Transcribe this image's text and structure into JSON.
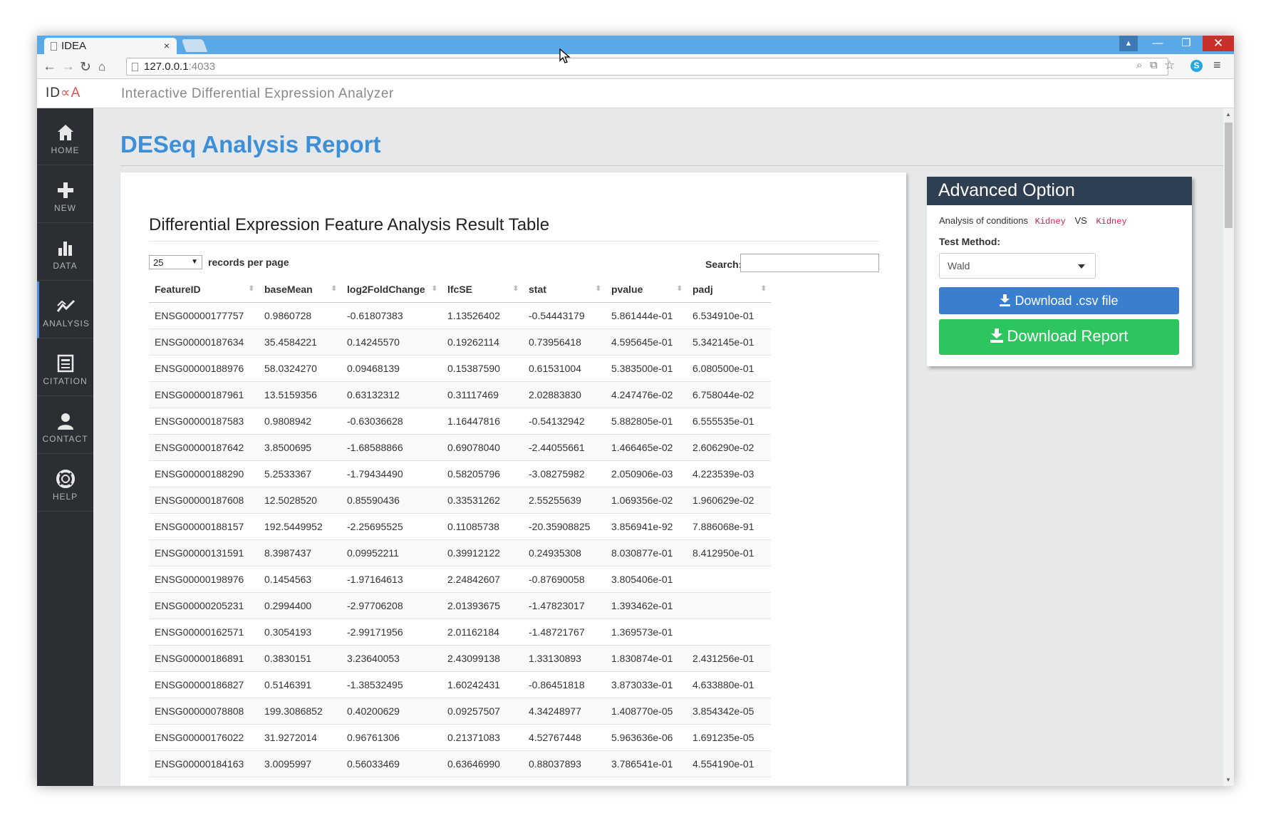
{
  "browser": {
    "tab_title": "IDEA",
    "tab_close": "×",
    "url_host": "127.0.0.1",
    "url_port": ":4033",
    "window_min": "—",
    "window_max": "❐",
    "window_close": "✕",
    "user_icon": "user-icon"
  },
  "app": {
    "logo_text": "ID",
    "logo_wave": "∝A",
    "title": "Interactive Differential Expression Analyzer"
  },
  "sidebar": {
    "items": [
      {
        "label": "HOME",
        "icon": "home-icon"
      },
      {
        "label": "NEW",
        "icon": "plus-icon"
      },
      {
        "label": "DATA",
        "icon": "bar-chart-icon"
      },
      {
        "label": "ANALYSIS",
        "icon": "line-chart-icon",
        "active": true
      },
      {
        "label": "CITATION",
        "icon": "document-icon"
      },
      {
        "label": "CONTACT",
        "icon": "user-icon"
      },
      {
        "label": "HELP",
        "icon": "lifebuoy-icon"
      }
    ]
  },
  "main": {
    "page_title": "DESeq Analysis Report",
    "panel_heading": "Differential Expression Feature Analysis Result Table",
    "length_value": "25",
    "length_label": "records per page",
    "search_label": "Search:",
    "table": {
      "headers": [
        "FeatureID",
        "baseMean",
        "log2FoldChange",
        "lfcSE",
        "stat",
        "pvalue",
        "padj"
      ],
      "rows": [
        [
          "ENSG00000177757",
          "0.9860728",
          "-0.61807383",
          "1.13526402",
          "-0.54443179",
          "5.861444e-01",
          "6.534910e-01"
        ],
        [
          "ENSG00000187634",
          "35.4584221",
          "0.14245570",
          "0.19262114",
          "0.73956418",
          "4.595645e-01",
          "5.342145e-01"
        ],
        [
          "ENSG00000188976",
          "58.0324270",
          "0.09468139",
          "0.15387590",
          "0.61531004",
          "5.383500e-01",
          "6.080500e-01"
        ],
        [
          "ENSG00000187961",
          "13.5159356",
          "0.63132312",
          "0.31117469",
          "2.02883830",
          "4.247476e-02",
          "6.758044e-02"
        ],
        [
          "ENSG00000187583",
          "0.9808942",
          "-0.63036628",
          "1.16447816",
          "-0.54132942",
          "5.882805e-01",
          "6.555535e-01"
        ],
        [
          "ENSG00000187642",
          "3.8500695",
          "-1.68588866",
          "0.69078040",
          "-2.44055661",
          "1.466465e-02",
          "2.606290e-02"
        ],
        [
          "ENSG00000188290",
          "5.2533367",
          "-1.79434490",
          "0.58205796",
          "-3.08275982",
          "2.050906e-03",
          "4.223539e-03"
        ],
        [
          "ENSG00000187608",
          "12.5028520",
          "0.85590436",
          "0.33531262",
          "2.55255639",
          "1.069356e-02",
          "1.960629e-02"
        ],
        [
          "ENSG00000188157",
          "192.5449952",
          "-2.25695525",
          "0.11085738",
          "-20.35908825",
          "3.856941e-92",
          "7.886068e-91"
        ],
        [
          "ENSG00000131591",
          "8.3987437",
          "0.09952211",
          "0.39912122",
          "0.24935308",
          "8.030877e-01",
          "8.412950e-01"
        ],
        [
          "ENSG00000198976",
          "0.1454563",
          "-1.97164613",
          "2.24842607",
          "-0.87690058",
          "3.805406e-01",
          ""
        ],
        [
          "ENSG00000205231",
          "0.2994400",
          "-2.97706208",
          "2.01393675",
          "-1.47823017",
          "1.393462e-01",
          ""
        ],
        [
          "ENSG00000162571",
          "0.3054193",
          "-2.99171956",
          "2.01162184",
          "-1.48721767",
          "1.369573e-01",
          ""
        ],
        [
          "ENSG00000186891",
          "0.3830151",
          "3.23640053",
          "2.43099138",
          "1.33130893",
          "1.830874e-01",
          "2.431256e-01"
        ],
        [
          "ENSG00000186827",
          "0.5146391",
          "-1.38532495",
          "1.60242431",
          "-0.86451818",
          "3.873033e-01",
          "4.633880e-01"
        ],
        [
          "ENSG00000078808",
          "199.3086852",
          "0.40200629",
          "0.09257507",
          "4.34248977",
          "1.408770e-05",
          "3.854342e-05"
        ],
        [
          "ENSG00000176022",
          "31.9272014",
          "0.96761306",
          "0.21371083",
          "4.52767448",
          "5.963636e-06",
          "1.691235e-05"
        ],
        [
          "ENSG00000184163",
          "3.0095997",
          "0.56033469",
          "0.63646990",
          "0.88037893",
          "3.786541e-01",
          "4.554190e-01"
        ]
      ]
    }
  },
  "advanced": {
    "title": "Advanced Option",
    "conditions_label": "Analysis of conditions",
    "condition_a": "Kidney",
    "vs": "VS",
    "condition_b": "Kidney",
    "test_method_label": "Test Method:",
    "test_method_value": "Wald",
    "download_csv": "Download .csv file",
    "download_report": "Download Report"
  },
  "colors": {
    "accent": "#3d8fd8",
    "sidebar": "#2b2f33",
    "adv_header": "#2f3f52",
    "btn_primary": "#3a7fcd",
    "btn_success": "#2dc55e",
    "code": "#c7254e"
  }
}
